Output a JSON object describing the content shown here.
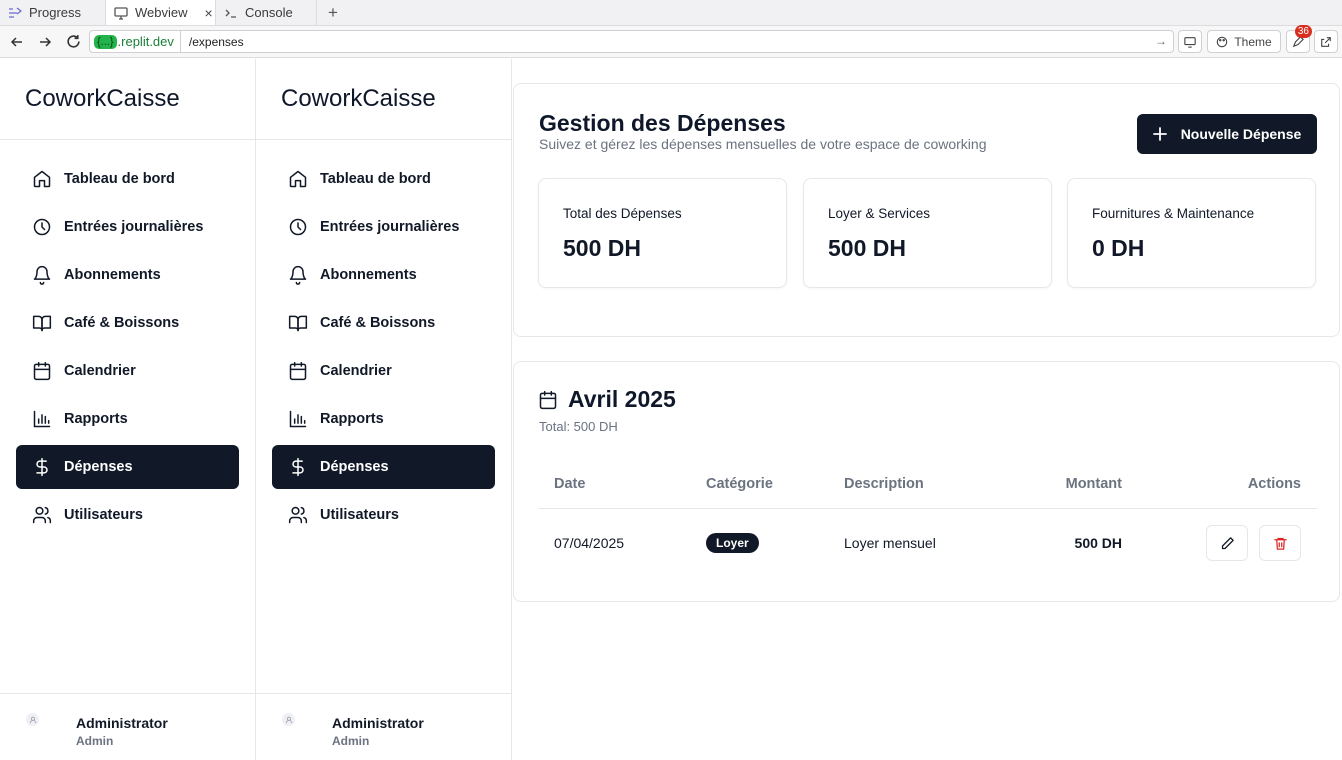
{
  "browser": {
    "tabs": [
      {
        "label": "Progress",
        "icon": "progress-icon"
      },
      {
        "label": "Webview",
        "icon": "monitor-icon",
        "active": true
      },
      {
        "label": "Console",
        "icon": "terminal-icon"
      }
    ],
    "host_pill": "{...}",
    "host": ".replit.dev",
    "path": "/expenses",
    "theme_label": "Theme",
    "badge_count": "36"
  },
  "sidebar": {
    "brand": "CoworkCaisse",
    "items": [
      {
        "label": "Tableau de bord",
        "icon": "home-icon"
      },
      {
        "label": "Entrées journalières",
        "icon": "clock-icon"
      },
      {
        "label": "Abonnements",
        "icon": "bell-icon"
      },
      {
        "label": "Café & Boissons",
        "icon": "book-icon"
      },
      {
        "label": "Calendrier",
        "icon": "calendar-icon"
      },
      {
        "label": "Rapports",
        "icon": "bar-chart-icon"
      },
      {
        "label": "Dépenses",
        "icon": "dollar-icon",
        "active": true
      },
      {
        "label": "Utilisateurs",
        "icon": "users-icon"
      }
    ],
    "user": {
      "name": "Administrator",
      "role": "Admin"
    }
  },
  "header": {
    "title": "Gestion des Dépenses",
    "subtitle": "Suivez et gérez les dépenses mensuelles de votre espace de coworking",
    "new_button": "Nouvelle Dépense"
  },
  "stats": [
    {
      "label": "Total des Dépenses",
      "value": "500 DH"
    },
    {
      "label": "Loyer & Services",
      "value": "500 DH"
    },
    {
      "label": "Fournitures & Maintenance",
      "value": "0 DH"
    }
  ],
  "month_section": {
    "title": "Avril 2025",
    "total": "Total: 500 DH",
    "columns": [
      "Date",
      "Catégorie",
      "Description",
      "Montant",
      "Actions"
    ],
    "rows": [
      {
        "date": "07/04/2025",
        "category": "Loyer",
        "description": "Loyer mensuel",
        "amount": "500 DH"
      }
    ]
  },
  "colors": {
    "primary": "#111827",
    "muted": "#6b7280",
    "border": "#e5e7eb",
    "danger": "#dc2626",
    "replit_green": "#22b34a"
  }
}
